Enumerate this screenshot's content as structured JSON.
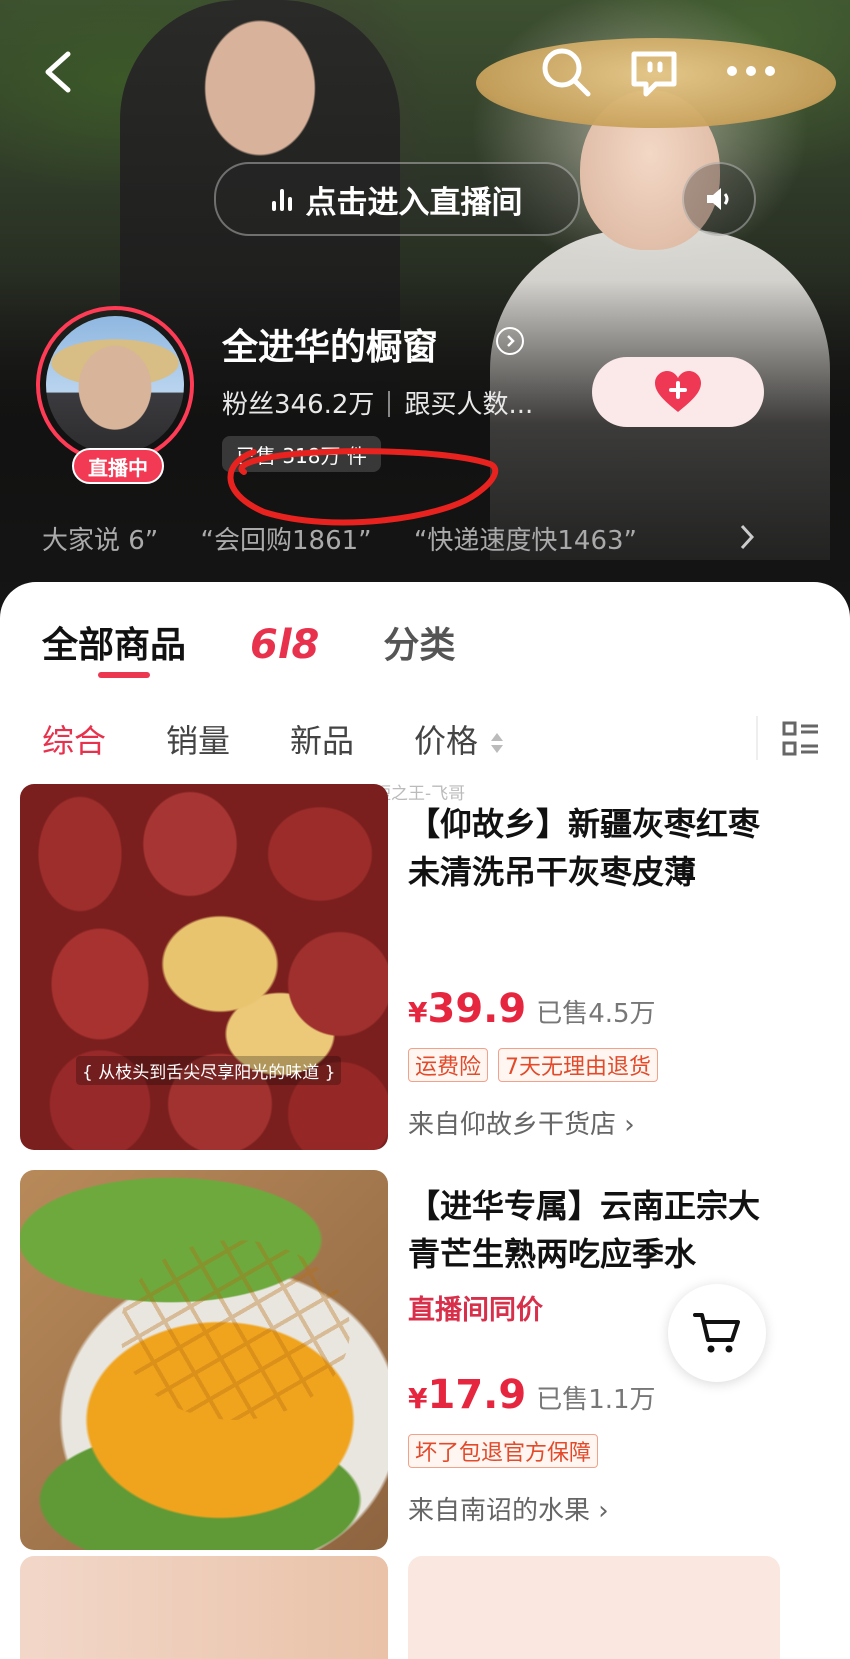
{
  "header": {
    "back_icon": "chevron-left-icon",
    "search_icon": "search-icon",
    "chat_icon": "message-icon",
    "more_icon": "more-icon",
    "enter_live_label": "点击进入直播间",
    "sound_icon": "speaker-icon"
  },
  "shop": {
    "live_badge": "直播中",
    "name": "全进华的橱窗",
    "fans": "粉丝346.2万",
    "followers": "跟买人数...",
    "sold": "已售 318万 件",
    "follow_icon": "heart-plus-icon"
  },
  "reviews": {
    "items": [
      "大家说 6”",
      "“会回购1861”",
      "“快递速度快1463”"
    ]
  },
  "tabs": [
    "全部商品",
    "6l8",
    "分类"
  ],
  "sort": {
    "items": [
      "综合",
      "销量",
      "新品",
      "价格"
    ]
  },
  "watermark": "@超短之王-飞哥",
  "products": [
    {
      "title": "【仰故乡】新疆灰枣红枣未清洗吊干灰枣皮薄",
      "image_caption": "{ 从枝头到舌尖尽享阳光的味道 }",
      "currency": "¥",
      "price": "39.9",
      "sold": "已售4.5万",
      "tags": [
        "运费险",
        "7天无理由退货"
      ],
      "store": "来自仰故乡干货店 ›"
    },
    {
      "title": "【进华专属】云南正宗大青芒生熟两吃应季水",
      "badge": "直播间同价",
      "currency": "¥",
      "price": "17.9",
      "sold": "已售1.1万",
      "tags": [
        "坏了包退官方保障"
      ],
      "store": "来自南诏的水果 ›"
    }
  ],
  "colors": {
    "accent": "#e8324d",
    "live_red": "#f23a54"
  }
}
